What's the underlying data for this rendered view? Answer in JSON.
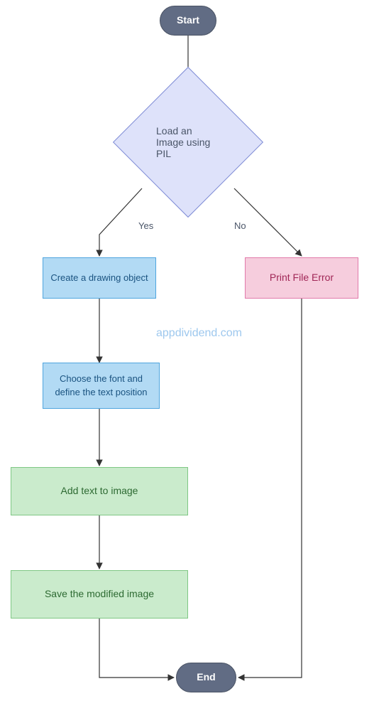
{
  "chart_data": {
    "type": "flowchart",
    "nodes": [
      {
        "id": "start",
        "kind": "terminator",
        "label": "Start"
      },
      {
        "id": "load",
        "kind": "decision",
        "label": "Load an Image using PIL"
      },
      {
        "id": "create_draw",
        "kind": "process",
        "label": "Create a drawing object"
      },
      {
        "id": "print_err",
        "kind": "process",
        "label": "Print File Error"
      },
      {
        "id": "choose_font",
        "kind": "process",
        "label": "Choose the font and define the text position"
      },
      {
        "id": "add_text",
        "kind": "process",
        "label": "Add text to image"
      },
      {
        "id": "save_img",
        "kind": "process",
        "label": "Save the modified image"
      },
      {
        "id": "end",
        "kind": "terminator",
        "label": "End"
      }
    ],
    "edges": [
      {
        "from": "start",
        "to": "load",
        "label": ""
      },
      {
        "from": "load",
        "to": "create_draw",
        "label": "Yes"
      },
      {
        "from": "load",
        "to": "print_err",
        "label": "No"
      },
      {
        "from": "create_draw",
        "to": "choose_font",
        "label": ""
      },
      {
        "from": "choose_font",
        "to": "add_text",
        "label": ""
      },
      {
        "from": "add_text",
        "to": "save_img",
        "label": ""
      },
      {
        "from": "save_img",
        "to": "end",
        "label": ""
      },
      {
        "from": "print_err",
        "to": "end",
        "label": ""
      }
    ]
  },
  "labels": {
    "start": "Start",
    "load": "Load an Image using PIL",
    "yes": "Yes",
    "no": "No",
    "create_draw": "Create a drawing object",
    "print_err": "Print File Error",
    "choose_font": "Choose the font and define the text position",
    "add_text": "Add text to image",
    "save_img": "Save the modified image",
    "end": "End",
    "watermark": "appdividend.com"
  },
  "colors": {
    "terminator_bg": "#616C84",
    "decision_bg": "#DEE2FA",
    "decision_border": "#808DD6",
    "blue_bg": "#B2DAF4",
    "blue_border": "#4FA5DE",
    "pink_bg": "#F6CDDD",
    "pink_border": "#E17AAA",
    "green_bg": "#CAEBCC",
    "green_border": "#7FC784",
    "watermark": "#9EC8EE"
  }
}
